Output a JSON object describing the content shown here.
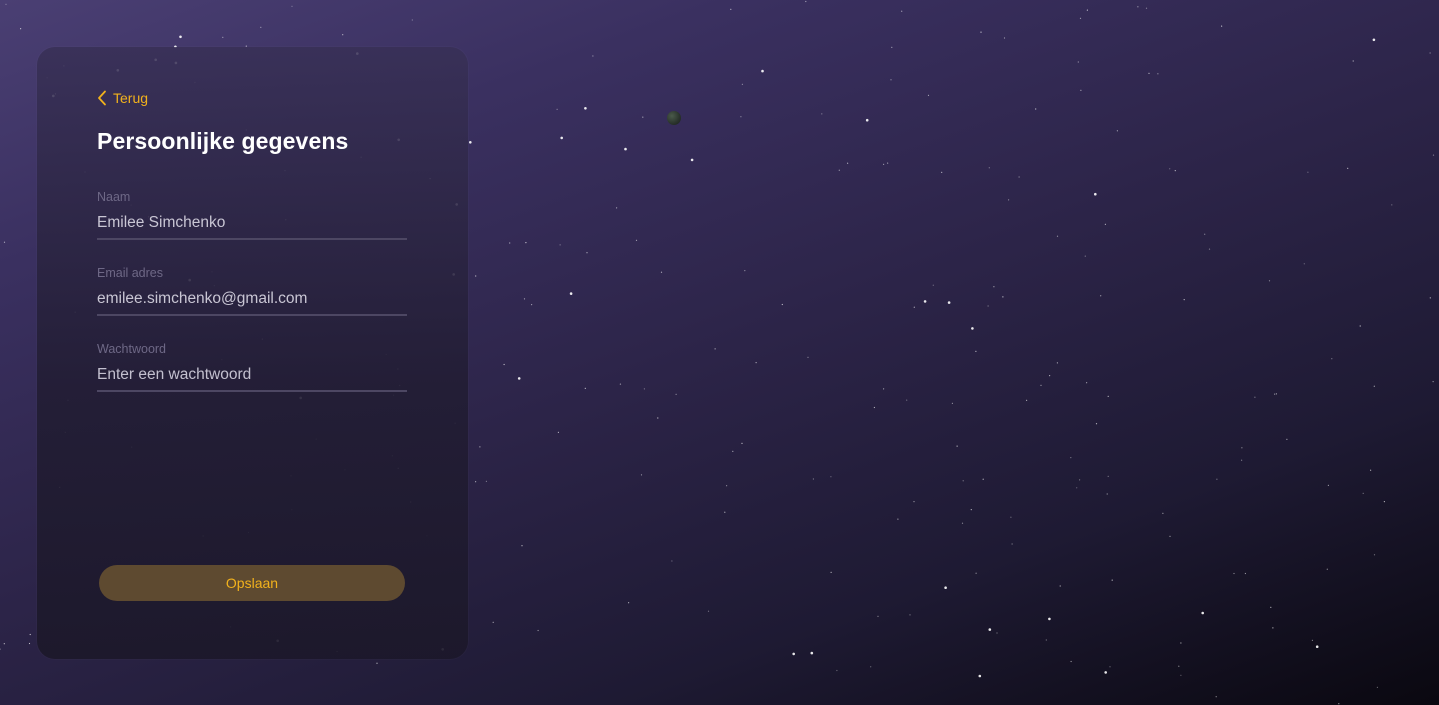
{
  "form": {
    "back_label": "Terug",
    "title": "Persoonlijke gegevens",
    "fields": [
      {
        "label": "Naam",
        "value": "Emilee Simchenko",
        "placeholder": ""
      },
      {
        "label": "Email adres",
        "value": "emilee.simchenko@gmail.com",
        "placeholder": ""
      },
      {
        "label": "Wachtwoord",
        "value": "",
        "placeholder": "Enter een wachtwoord"
      }
    ],
    "save_label": "Opslaan"
  },
  "icons": {
    "back": "chevron-left-icon"
  },
  "colors": {
    "accent": "#f2b21c",
    "button_bg": "#5e4a30",
    "background_top": "#4a3f73",
    "background_bottom": "#0a0810"
  }
}
